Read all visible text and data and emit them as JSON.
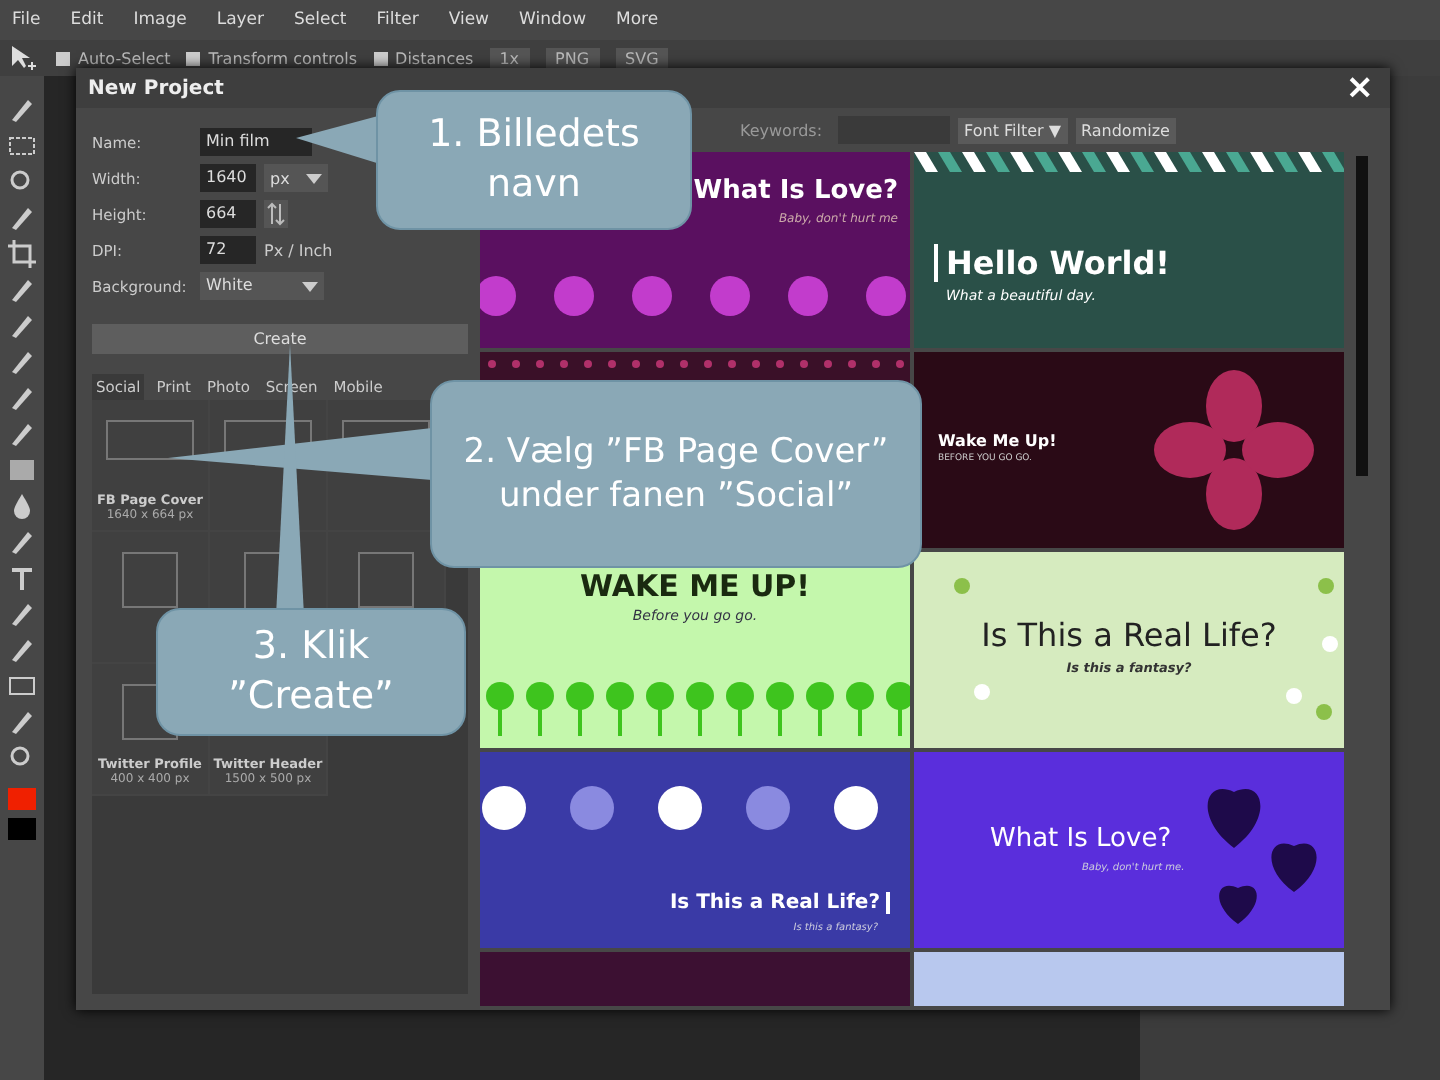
{
  "menu": [
    "File",
    "Edit",
    "Image",
    "Layer",
    "Select",
    "Filter",
    "View",
    "Window",
    "More"
  ],
  "options_bar": {
    "checkboxes": [
      {
        "label": "Auto-Select",
        "checked": false
      },
      {
        "label": "Transform controls",
        "checked": false
      },
      {
        "label": "Distances",
        "checked": false
      }
    ],
    "zoom": "1x",
    "png": "PNG",
    "svg": "SVG"
  },
  "dialog": {
    "title": "New Project",
    "close": "×",
    "form": [
      {
        "label": "Name:",
        "value": "Min film",
        "kind": "text"
      },
      {
        "label": "Width:",
        "value": "1640",
        "unit": "px",
        "kind": "unit"
      },
      {
        "label": "Height:",
        "value": "664",
        "kind": "swap"
      },
      {
        "label": "DPI:",
        "value": "72",
        "unit": "Px / Inch",
        "kind": "fixed"
      },
      {
        "label": "Background:",
        "value": "White",
        "kind": "select"
      }
    ],
    "create": "Create",
    "tabs": [
      {
        "label": "Social",
        "selected": true
      },
      {
        "label": "Print",
        "selected": false
      },
      {
        "label": "Photo",
        "selected": false
      },
      {
        "label": "Screen",
        "selected": false
      },
      {
        "label": "Mobile",
        "selected": false
      }
    ],
    "presets": [
      {
        "name": "FB Page Cover",
        "size": "1640 x 664 px",
        "kind": "wide"
      },
      {
        "kind": "wide"
      },
      {
        "kind": "wide"
      },
      {
        "kind": "square"
      },
      {
        "kind": "tall"
      },
      {
        "kind": "square"
      },
      {
        "name": "Twitter Profile",
        "size": "400 x 400 px",
        "kind": "square"
      },
      {
        "name": "Twitter Header",
        "size": "1500 x 500 px",
        "kind": "covered"
      }
    ],
    "keywords_label": "Keywords:",
    "font_filter": "Font Filter ▼",
    "randomize": "Randomize",
    "templates": [
      {
        "kind": "dots",
        "title": "What Is Love?",
        "subtitle": "Baby, don't hurt me"
      },
      {
        "kind": "stripes",
        "title": "Hello World!",
        "subtitle": "What a beautiful day."
      },
      {
        "kind": "covered"
      },
      {
        "kind": "flower",
        "title": "Wake Me Up!",
        "subtitle": "BEFORE YOU GO GO."
      },
      {
        "kind": "flowers",
        "title": "WAKE ME UP!",
        "subtitle": "Before you go go."
      },
      {
        "kind": "light-dots",
        "title": "Is This a Real Life?",
        "subtitle": "Is this a fantasy?"
      },
      {
        "kind": "circles",
        "title": "Is This a Real Life?",
        "subtitle": "Is this a fantasy?"
      },
      {
        "kind": "hearts",
        "title": "What Is Love?",
        "subtitle": "Baby, don't hurt me."
      },
      {
        "kind": "dark-cut"
      },
      {
        "kind": "light-cut"
      }
    ]
  },
  "callouts": [
    {
      "text": "1. Billedets navn"
    },
    {
      "text": "2. Vælg ”FB Page Cover” under fanen ”Social”"
    },
    {
      "text": "3. Klik ”Create”"
    }
  ]
}
